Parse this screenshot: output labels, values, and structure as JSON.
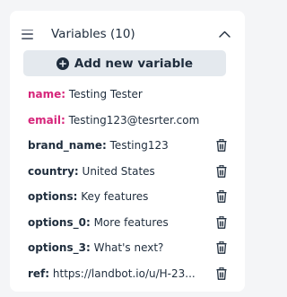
{
  "header": {
    "title": "Variables (10)",
    "menu_icon": "hamburger-menu-icon",
    "collapse_icon": "chevron-up-icon"
  },
  "add_button": {
    "label": "Add new variable",
    "icon": "plus-circle-icon"
  },
  "colors": {
    "system_variable_name": "#d6257a",
    "text": "#1f2d3d",
    "button_bg": "#e4e9ee"
  },
  "variables": [
    {
      "name": "name:",
      "value": " Testing Tester",
      "system": true,
      "deletable": false
    },
    {
      "name": "email:",
      "value": " Testing123@tesrter.com",
      "system": true,
      "deletable": false
    },
    {
      "name": "brand_name:",
      "value": " Testing123",
      "system": false,
      "deletable": true
    },
    {
      "name": "country:",
      "value": " United States",
      "system": false,
      "deletable": true
    },
    {
      "name": "options:",
      "value": " Key features",
      "system": false,
      "deletable": true
    },
    {
      "name": "options_0:",
      "value": " More features",
      "system": false,
      "deletable": true
    },
    {
      "name": "options_3:",
      "value": " What's next?",
      "system": false,
      "deletable": true
    },
    {
      "name": "ref:",
      "value": " https://landbot.io/u/H-23...",
      "system": false,
      "deletable": true
    }
  ]
}
